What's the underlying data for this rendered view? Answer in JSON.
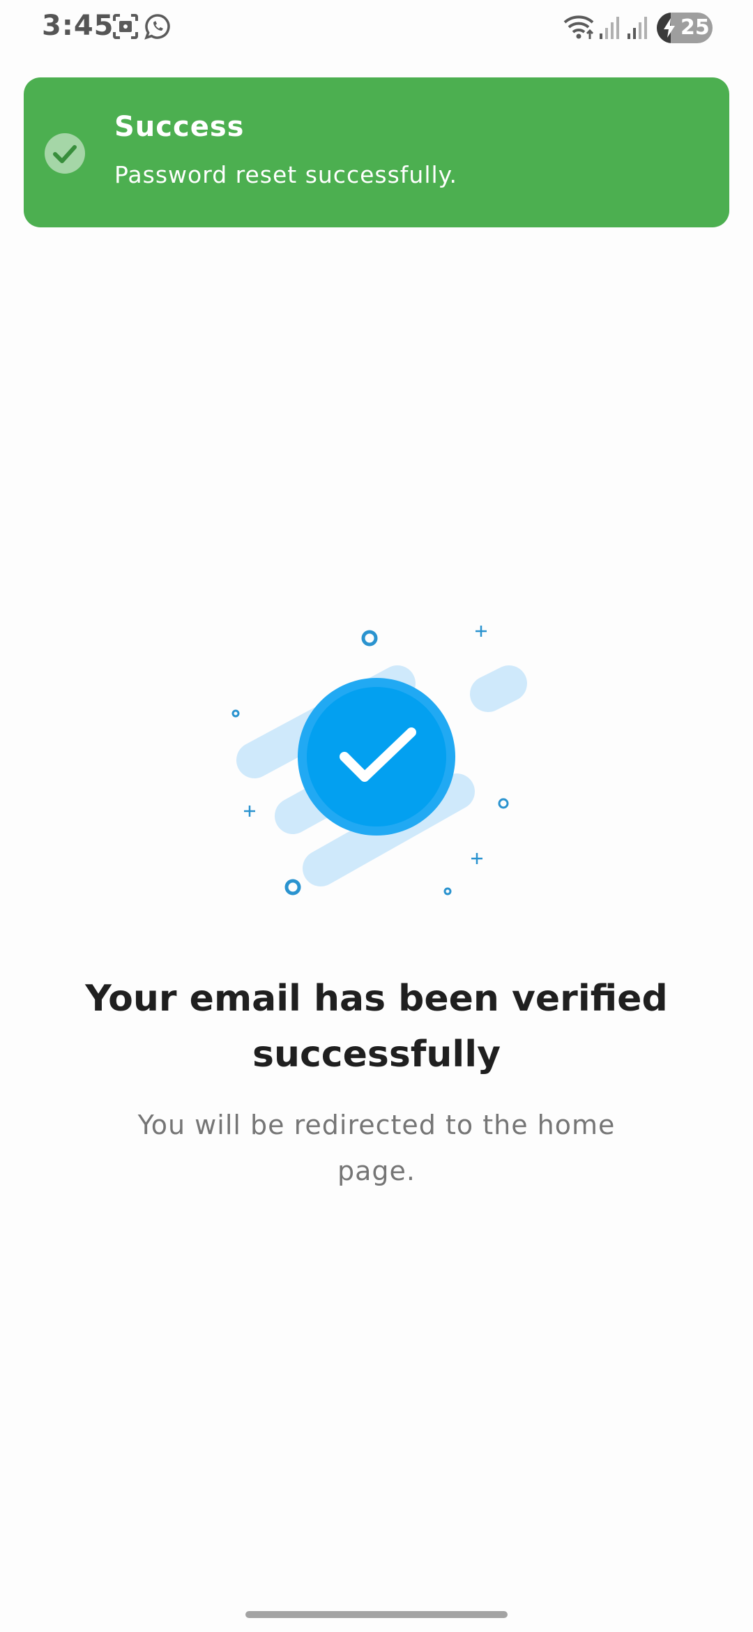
{
  "status_bar": {
    "time": "3:45",
    "battery_level": "25",
    "battery_fraction": 0.25,
    "icons": [
      "screenshot-icon",
      "whatsapp-icon",
      "wifi-icon",
      "signal-icon",
      "signal-icon",
      "battery-charging-icon"
    ]
  },
  "toast": {
    "title": "Success",
    "message": "Password reset successfully.",
    "icon": "check-circle-icon",
    "color": "#4caf50"
  },
  "main": {
    "headline": "Your email has been verified successfully",
    "subtext": "You will be redirected to the home page.",
    "illustration_icon": "verified-check-icon",
    "accent_color": "#03a0f0"
  }
}
